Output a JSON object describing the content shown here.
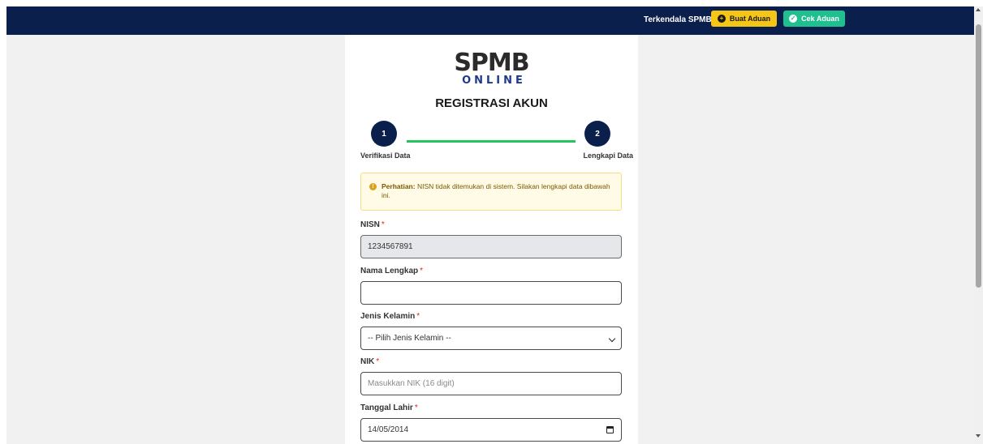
{
  "topbar": {
    "help_label": "Terkendala SPMB ?",
    "buttons": [
      {
        "label": "Buat Aduan",
        "icon": "plus-circle-icon",
        "color": "#f5c518"
      },
      {
        "label": "Cek Aduan",
        "icon": "check-circle-icon",
        "color": "#1fbf8f"
      }
    ],
    "background": "#0b1f4d"
  },
  "logo": {
    "main": "SPMB",
    "sub": "ONLINE"
  },
  "page_title": "REGISTRASI AKUN",
  "stepper": {
    "steps": [
      {
        "number": "1",
        "label": "Verifikasi Data"
      },
      {
        "number": "2",
        "label": "Lengkapi Data"
      }
    ],
    "line_color": "#22c55e"
  },
  "alert": {
    "icon": "exclamation-circle-icon",
    "title": "Perhatian:",
    "message": "NISN tidak ditemukan di sistem. Silakan lengkapi data dibawah ini."
  },
  "form": {
    "nisn": {
      "label": "NISN",
      "required": "*",
      "value": "1234567891"
    },
    "nama": {
      "label": "Nama Lengkap",
      "required": "*",
      "value": ""
    },
    "jenis_kelamin": {
      "label": "Jenis Kelamin",
      "required": "*",
      "selected": "-- Pilih Jenis Kelamin --"
    },
    "nik": {
      "label": "NIK",
      "required": "*",
      "placeholder": "Masukkan NIK (16 digit)"
    },
    "tanggal_lahir": {
      "label": "Tanggal Lahir",
      "required": "*",
      "value": "14/05/2014"
    }
  }
}
